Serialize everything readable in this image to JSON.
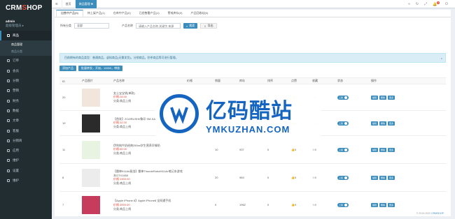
{
  "logo": {
    "a": "CRM",
    "b": "S",
    "c": "HOP"
  },
  "user": {
    "name": "admin",
    "role": "超级管理员 ▸"
  },
  "sidebar": {
    "search": "搜索菜单",
    "items": [
      {
        "label": "商品"
      },
      {
        "label": "订单"
      },
      {
        "label": "会员"
      },
      {
        "label": "分销"
      },
      {
        "label": "营销"
      },
      {
        "label": "财务"
      },
      {
        "label": "数据"
      },
      {
        "label": "文章"
      },
      {
        "label": "客服"
      },
      {
        "label": "分销商"
      },
      {
        "label": "应用"
      },
      {
        "label": "维护"
      },
      {
        "label": "设置"
      },
      {
        "label": "维护"
      }
    ],
    "sub": [
      {
        "label": "商品管理"
      },
      {
        "label": "商品分类"
      }
    ]
  },
  "topbar": {
    "home": "首页",
    "current": "商品管理 ✖",
    "badge": "5"
  },
  "tabs": [
    {
      "label": "出售中产品(5)"
    },
    {
      "label": "待上架产品(1)"
    },
    {
      "label": "仓库中产品(0)"
    },
    {
      "label": "已经售罄产品(1)"
    },
    {
      "label": "警戒库存(0)"
    },
    {
      "label": "产品回收站(0)"
    }
  ],
  "filter": {
    "cat_label": "所有分类",
    "cat_value": "全部",
    "name_label": "产品名称",
    "placeholder": "请输入产品名称,关键字,来源",
    "search": "搜索",
    "export": "导出"
  },
  "notice": "目前拥有的商品类型：普通商品，虚拟商品(无需发货)，分销商品，秒杀商品等可进行管理。",
  "actions": {
    "add": "添加产品",
    "batch": "批量转发，开始，10000，审核"
  },
  "table": {
    "headers": [
      "ID",
      "产品图片",
      "产品名称",
      "价格",
      "销量",
      "库存",
      "排序",
      "点赞",
      "收藏",
      "状态",
      "操作"
    ],
    "rows": [
      {
        "id": "20",
        "name": "女士宝宝袋(单款)",
        "price": "价格:28.00",
        "sales": "",
        "stock": "",
        "sort": "",
        "likes": "0",
        "fav": "0"
      },
      {
        "id": "19",
        "name": "【首发】ZOJIRUSHI/象印 SM-SA48 保温杯",
        "price": "价格:32.00",
        "sales": "",
        "stock": "",
        "sort": "",
        "likes": "0",
        "fav": "0"
      },
      {
        "id": "11",
        "name": "伊利纯牛奶经典250ml学生营养早餐奶",
        "price": "价格:80.00",
        "sales": "10",
        "stock": "937",
        "sort": "0",
        "likes": "0",
        "fav": "0"
      },
      {
        "id": "8",
        "name": "【雷神911Air星战】雷神ThundeRobot911Air笔记本游戏本GTX1650",
        "price": "价格:1900.00",
        "sales": "20",
        "stock": "983",
        "sort": "0",
        "likes": "0",
        "fav": "0"
      },
      {
        "id": "7",
        "name": "【Apple iPhone 8】Apple iPhone8 全网通手机",
        "price": "价格:3000.00",
        "sales": "0",
        "stock": "1962",
        "sort": "0",
        "likes": "0",
        "fav": "0"
      }
    ],
    "status": "上架",
    "ops": [
      "编辑",
      "删除",
      "更多"
    ],
    "cat_prefix": "分类:商品上线"
  },
  "footer": {
    "text": "© 2019-2020 ",
    "brand": "CRMSHOP"
  },
  "watermark": {
    "cn": "亿码酷站",
    "en": "YMKUZHAN.COM"
  }
}
